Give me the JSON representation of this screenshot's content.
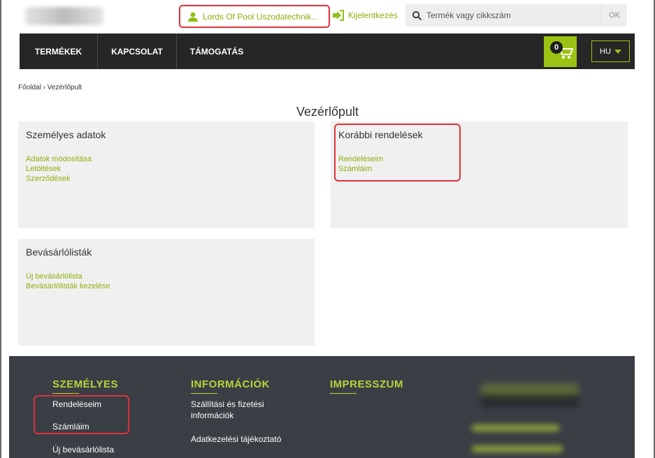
{
  "header": {
    "user_name": "Lords Of Pool Uszodatechnik...",
    "logout_label": "Kijelentkezés",
    "search_placeholder": "Termék vagy cikkszám",
    "search_button": "OK"
  },
  "nav": {
    "items": [
      "TERMÉKEK",
      "KAPCSOLAT",
      "TÁMOGATÁS"
    ],
    "cart_count": "0",
    "language": "HU"
  },
  "breadcrumb": "Főoldal › Vezérlőpult",
  "page_title": "Vezérlőpult",
  "cards": {
    "personal": {
      "title": "Személyes adatok",
      "links": [
        "Adatok módosítása",
        "Letöltések",
        "Szerződések"
      ]
    },
    "orders": {
      "title": "Korábbi rendelések",
      "links": [
        "Rendeléseim",
        "Számláim"
      ]
    },
    "lists": {
      "title": "Bevásárlólisták",
      "links": [
        "Új bevásárlólista",
        "Bevásárlólisták kezelése"
      ]
    }
  },
  "footer": {
    "col1": {
      "title": "SZEMÉLYES",
      "links": [
        "Rendeléseim",
        "Számláim",
        "Új bevásárlólista"
      ]
    },
    "col2": {
      "title": "INFORMÁCIÓK",
      "links": [
        "Szállítási és fizetési\ninformációk",
        "Adatkezelési tájékoztató"
      ]
    },
    "col3": {
      "title": "IMPRESSZUM"
    }
  },
  "colors": {
    "accent": "#9cc313",
    "link": "#8cb10c",
    "nav_bg": "#262626",
    "footer_bg": "#3a3f45",
    "highlight": "#e0303a"
  },
  "icons": {
    "user": "user-icon",
    "logout": "logout-icon",
    "search": "search-icon",
    "cart": "cart-icon",
    "language_caret": "caret-down-icon"
  }
}
